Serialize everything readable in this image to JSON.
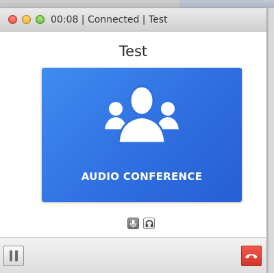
{
  "window": {
    "title": "00:08 | Connected | Test"
  },
  "conference": {
    "name": "Test",
    "type_label": "AUDIO CONFERENCE"
  },
  "controls": {
    "mic_icon": "microphone-icon",
    "headset_icon": "headphones-icon",
    "pause_icon": "pause-icon",
    "hangup_icon": "phone-hangup-icon"
  },
  "colors": {
    "card_accent": "#2f6fe0",
    "hangup": "#e0453a"
  }
}
